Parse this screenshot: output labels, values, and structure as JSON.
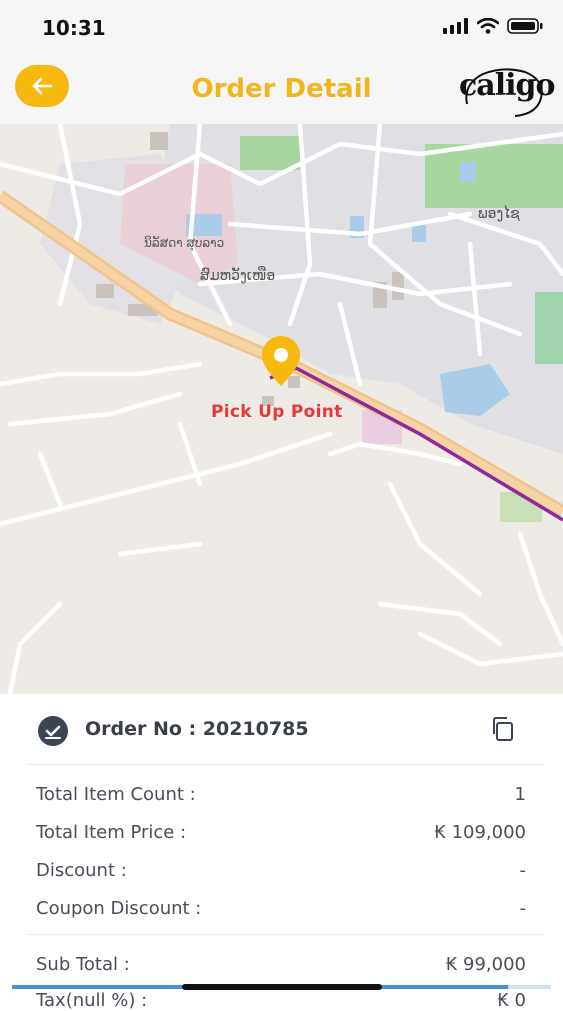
{
  "status_bar": {
    "time": "10:31"
  },
  "header": {
    "title": "Order Detail",
    "logo_text": "caligo"
  },
  "map": {
    "pickup_label": "Pick Up Point",
    "labels": [
      "ພອງໄຊ",
      "ສົມຫວັງເໜືອ",
      "ນິລັສດາ ສຸບລາວ"
    ]
  },
  "order": {
    "label": "Order No : 20210785",
    "rows": [
      {
        "label": "Total Item Count :",
        "value": "1"
      },
      {
        "label": "Total Item Price :",
        "value": "₭ 109,000"
      },
      {
        "label": "Discount :",
        "value": "-"
      },
      {
        "label": "Coupon Discount :",
        "value": "-"
      }
    ],
    "subtotal": {
      "label": "Sub Total :",
      "value": "₭ 99,000"
    },
    "tax": {
      "label": "Tax(null %) :",
      "value": "₭ 0"
    }
  },
  "progress": {
    "value": 0.92
  },
  "colors": {
    "accent": "#f2b51d",
    "route": "#8e2a9b",
    "pin": "#f6b910",
    "pickup_text": "#e53a3a"
  }
}
